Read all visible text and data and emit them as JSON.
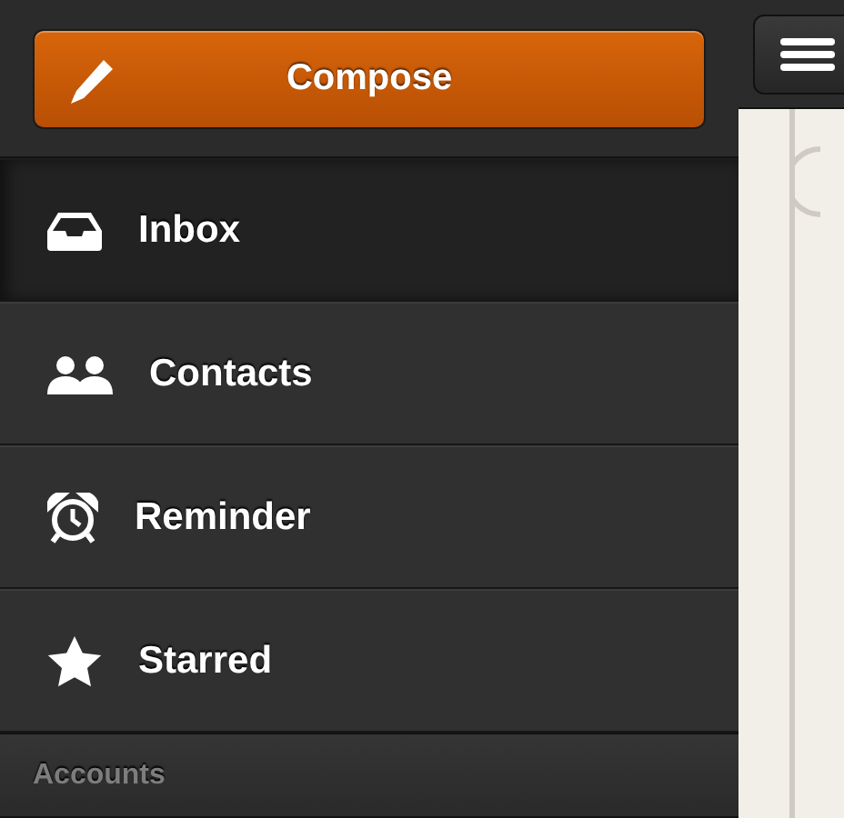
{
  "compose": {
    "label": "Compose"
  },
  "menu": [
    {
      "label": "Inbox",
      "selected": true
    },
    {
      "label": "Contacts",
      "selected": false
    },
    {
      "label": "Reminder",
      "selected": false
    },
    {
      "label": "Starred",
      "selected": false
    }
  ],
  "section": {
    "title": "Accounts"
  }
}
